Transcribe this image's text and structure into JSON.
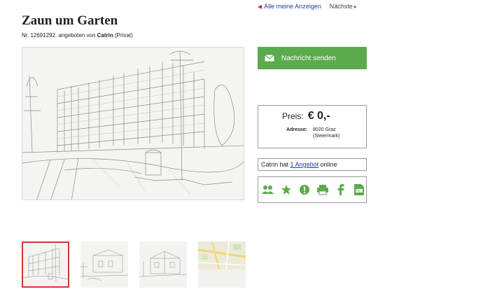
{
  "nav": {
    "all_ads_label": "Alle meine Anzeigen",
    "next_label": "Nächste"
  },
  "listing": {
    "title": "Zaun um Garten",
    "number_text": "Nr. 12691292. angeboten von",
    "seller": "Catrin",
    "seller_type": "(Privat)"
  },
  "contact": {
    "send_label": "Nachricht senden"
  },
  "price": {
    "label": "Preis:",
    "value": "€ 0,-",
    "address_label": "Adresse:",
    "address_line1": "8020 Graz",
    "address_line2": "(Steiermark)"
  },
  "offers": {
    "prefix": "Catrin hat",
    "link": "1 Angebot",
    "suffix": "online"
  },
  "share": {
    "icons": [
      "users-icon",
      "star-icon",
      "alert-icon",
      "print-icon",
      "facebook-icon",
      "pdf-icon"
    ],
    "accent_color": "#5bab4c"
  },
  "gallery": {
    "selected_index": 0,
    "thumbnails": [
      "fence-sketch",
      "house-sketch",
      "building-sketch",
      "map"
    ]
  },
  "colors": {
    "accent_green": "#5bab4c",
    "link_blue": "#1f3f9a",
    "selected_border": "#d13a31"
  }
}
